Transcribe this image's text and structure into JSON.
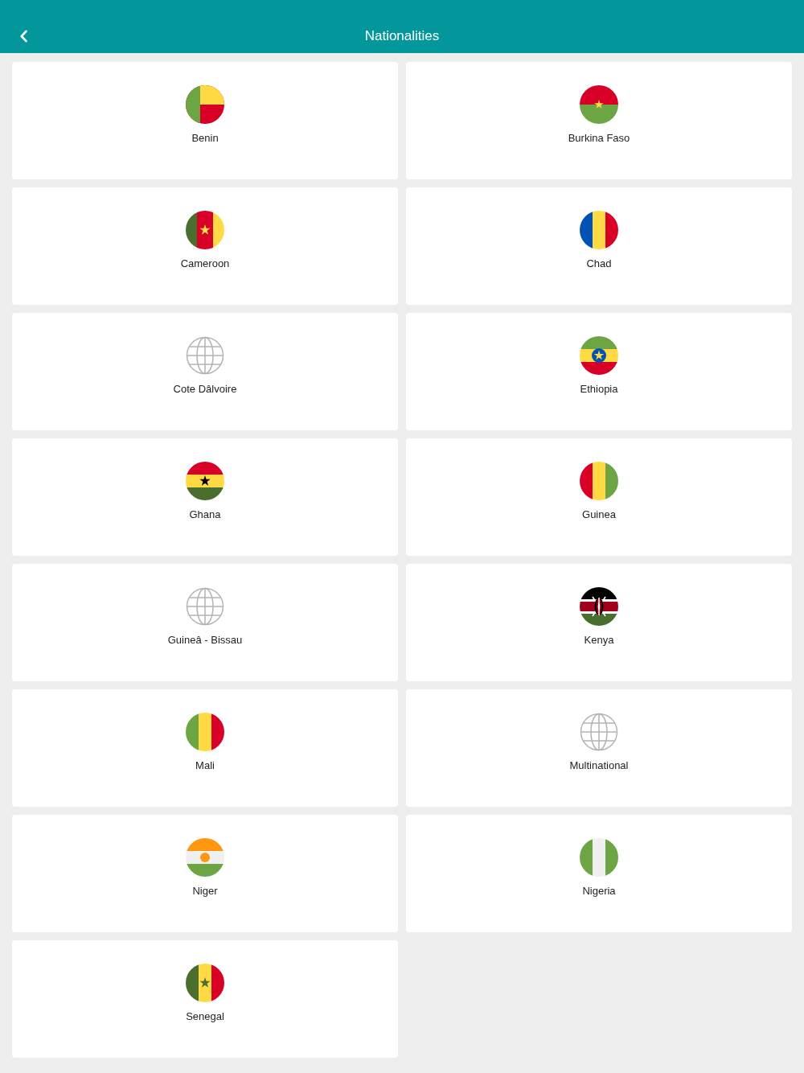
{
  "header": {
    "title": "Nationalities"
  },
  "nationalities": [
    {
      "name": "Benin",
      "kind": "flag"
    },
    {
      "name": "Burkina Faso",
      "kind": "flag"
    },
    {
      "name": "Cameroon",
      "kind": "flag"
    },
    {
      "name": "Chad",
      "kind": "flag"
    },
    {
      "name": "Cote Dâlvoire",
      "kind": "globe"
    },
    {
      "name": "Ethiopia",
      "kind": "flag"
    },
    {
      "name": "Ghana",
      "kind": "flag"
    },
    {
      "name": "Guinea",
      "kind": "flag"
    },
    {
      "name": "Guineâ - Bissau",
      "kind": "globe"
    },
    {
      "name": "Kenya",
      "kind": "flag"
    },
    {
      "name": "Mali",
      "kind": "flag"
    },
    {
      "name": "Multinational",
      "kind": "globe"
    },
    {
      "name": "Niger",
      "kind": "flag"
    },
    {
      "name": "Nigeria",
      "kind": "flag"
    },
    {
      "name": "Senegal",
      "kind": "flag"
    }
  ]
}
